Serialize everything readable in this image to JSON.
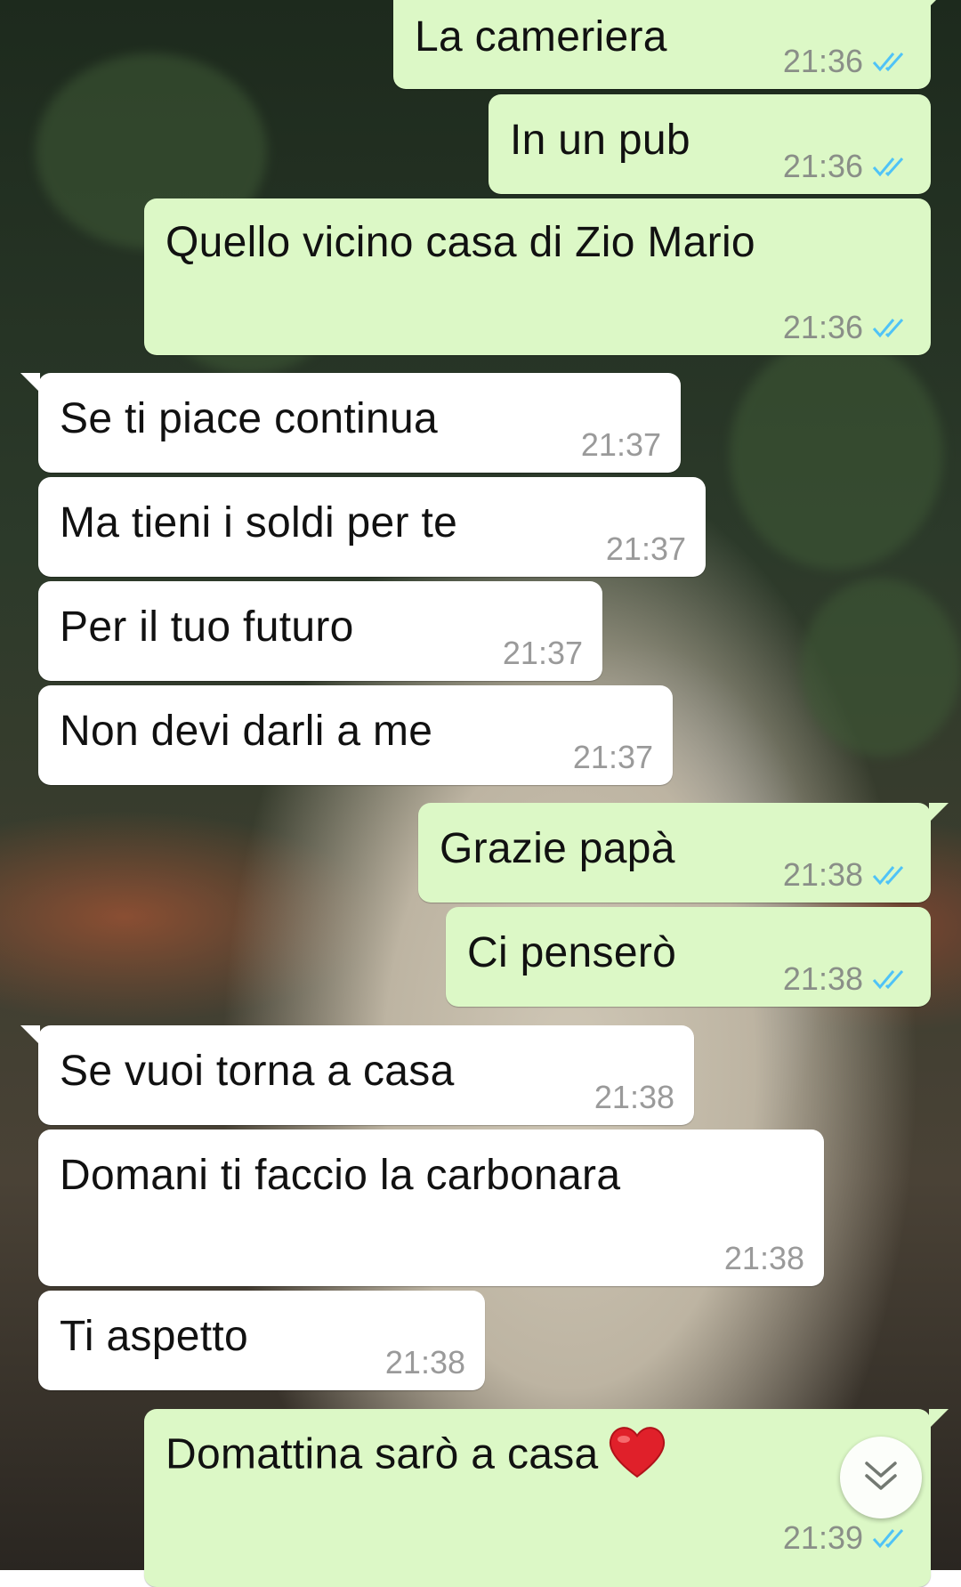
{
  "messages": [
    {
      "direction": "outgoing",
      "text": "La cameriera",
      "time": "21:36",
      "status": "read"
    },
    {
      "direction": "outgoing",
      "text": "In un pub",
      "time": "21:36",
      "status": "read"
    },
    {
      "direction": "outgoing",
      "text": "Quello vicino casa di Zio Mario",
      "time": "21:36",
      "status": "read"
    },
    {
      "direction": "incoming",
      "text": "Se ti piace continua",
      "time": "21:37"
    },
    {
      "direction": "incoming",
      "text": "Ma tieni i soldi per te",
      "time": "21:37"
    },
    {
      "direction": "incoming",
      "text": "Per il tuo futuro",
      "time": "21:37"
    },
    {
      "direction": "incoming",
      "text": "Non devi darli a me",
      "time": "21:37"
    },
    {
      "direction": "outgoing",
      "text": "Grazie papà",
      "time": "21:38",
      "status": "read"
    },
    {
      "direction": "outgoing",
      "text": "Ci penserò",
      "time": "21:38",
      "status": "read"
    },
    {
      "direction": "incoming",
      "text": "Se vuoi torna a casa",
      "time": "21:38"
    },
    {
      "direction": "incoming",
      "text": "Domani ti faccio la carbonara",
      "time": "21:38"
    },
    {
      "direction": "incoming",
      "text": "Ti aspetto",
      "time": "21:38"
    },
    {
      "direction": "outgoing",
      "text": "Domattina sarò a casa",
      "emoji": "red-heart",
      "time": "21:39",
      "status": "read"
    }
  ],
  "icons": {
    "read_receipt": "double-check-icon",
    "scroll_down": "chevron-double-down-icon"
  },
  "colors": {
    "outgoing_bubble": "#dcf8c6",
    "incoming_bubble": "#ffffff",
    "read_tick": "#4fc3f7",
    "heart": "#e0202a"
  }
}
